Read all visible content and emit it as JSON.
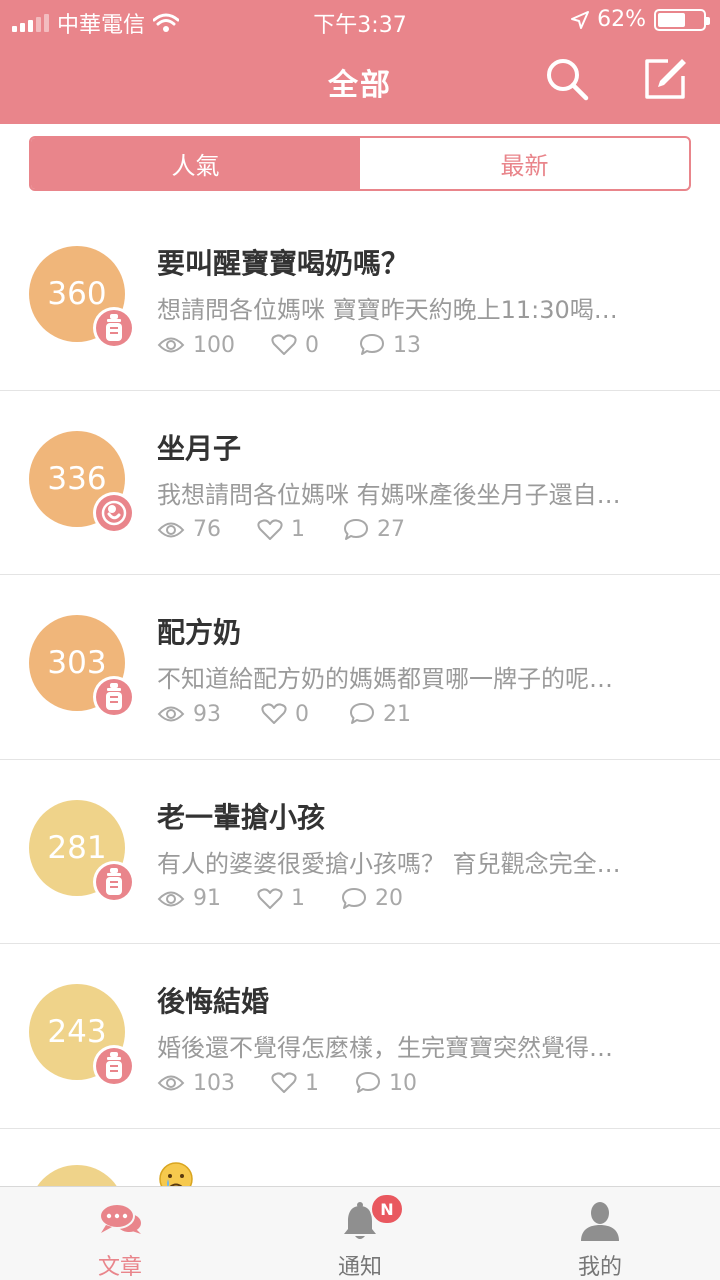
{
  "status_bar": {
    "carrier": "中華電信",
    "time": "下午3:37",
    "battery_percent": "62%",
    "battery_level": 0.62
  },
  "header": {
    "title": "全部",
    "search_icon": "search-icon",
    "compose_icon": "compose-icon"
  },
  "tabs": [
    {
      "label": "人氣",
      "active": true
    },
    {
      "label": "最新",
      "active": false
    }
  ],
  "colors": {
    "accent": "#E9858B",
    "score_high": "#F0B67A",
    "score_mid": "#EFD38A",
    "notif_badge": "#E9585F"
  },
  "posts": [
    {
      "score": "360",
      "badge_icon": "baby-bottle-icon",
      "title": "要叫醒寶寶喝奶嗎？",
      "excerpt": "想請問各位媽咪 寶寶昨天約晚上11:30喝…",
      "views": "100",
      "likes": "0",
      "comments": "13"
    },
    {
      "score": "336",
      "badge_icon": "fetus-icon",
      "title": "坐月子",
      "excerpt": "我想請問各位媽咪 有媽咪產後坐月子還自…",
      "views": "76",
      "likes": "1",
      "comments": "27"
    },
    {
      "score": "303",
      "badge_icon": "baby-bottle-icon",
      "title": "配方奶",
      "excerpt": "不知道給配方奶的媽媽都買哪一牌子的呢…",
      "views": "93",
      "likes": "0",
      "comments": "21"
    },
    {
      "score": "281",
      "badge_icon": "baby-bottle-icon",
      "title": "老一輩搶小孩",
      "excerpt": "有人的婆婆很愛搶小孩嗎？ 育兒觀念完全…",
      "views": "91",
      "likes": "1",
      "comments": "20"
    },
    {
      "score": "243",
      "badge_icon": "baby-bottle-icon",
      "title": "後悔結婚",
      "excerpt": "婚後還不覺得怎麼樣，生完寶寶突然覺得…",
      "views": "103",
      "likes": "1",
      "comments": "10"
    }
  ],
  "partial_post": {
    "title_icon": "crying-face-emoji-icon"
  },
  "tabbar": {
    "items": [
      {
        "label": "文章",
        "icon": "chat-bubbles-icon",
        "active": true
      },
      {
        "label": "通知",
        "icon": "bell-icon",
        "active": false,
        "badge": "N"
      },
      {
        "label": "我的",
        "icon": "person-icon",
        "active": false
      }
    ]
  }
}
